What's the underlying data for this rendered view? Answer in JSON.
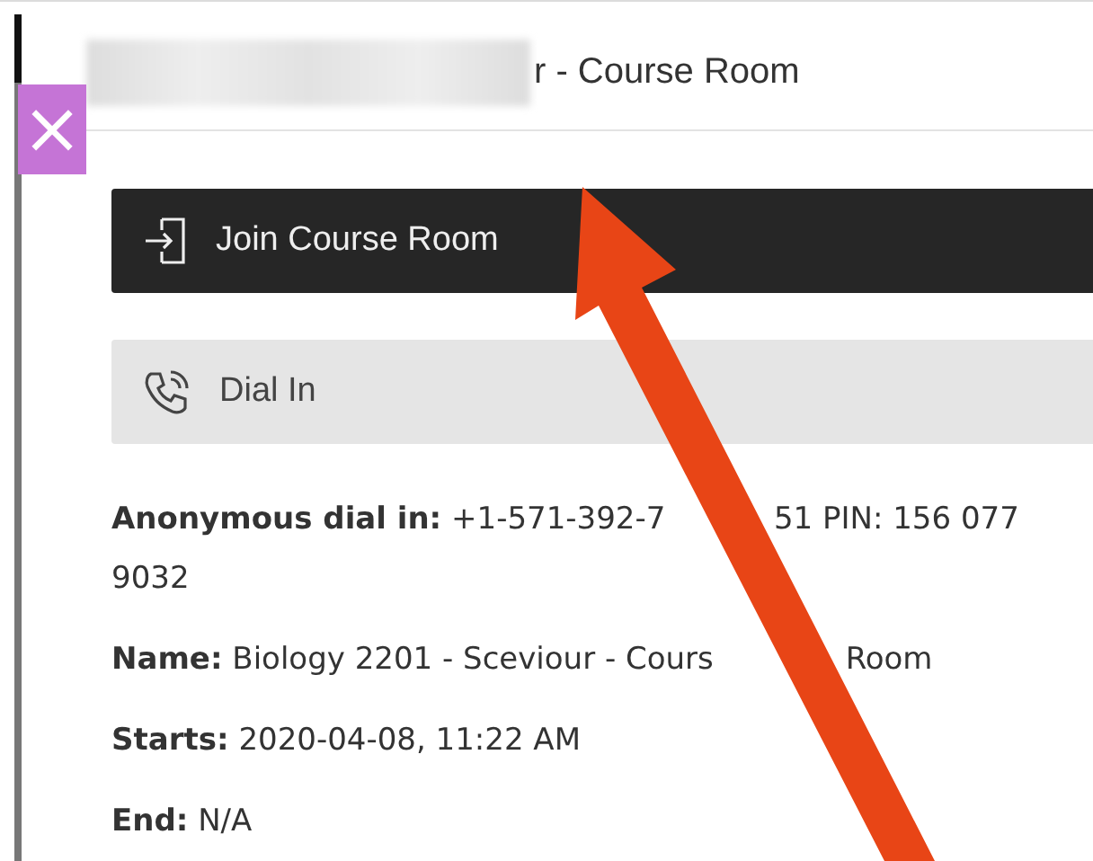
{
  "header": {
    "title_visible": "r - Course Room"
  },
  "close_button": {
    "label": "×"
  },
  "buttons": [
    {
      "label": "Join Course Room",
      "kind": "primary"
    },
    {
      "label": "Dial In",
      "kind": "secondary"
    }
  ],
  "details": [
    {
      "label": "Anonymous dial in:",
      "lines": [
        [
          "+1-571-392-7",
          "51 PIN: 156 077"
        ],
        [
          "9032"
        ]
      ]
    },
    {
      "label": "Name:",
      "lines": [
        [
          "Biology 2201 - Sceviour - Cours",
          "Room"
        ]
      ]
    },
    {
      "label": "Starts:",
      "lines": [
        [
          "2020-04-08, 11:22 AM"
        ]
      ]
    },
    {
      "label": "End:",
      "lines": [
        [
          "N/A"
        ]
      ]
    }
  ]
}
